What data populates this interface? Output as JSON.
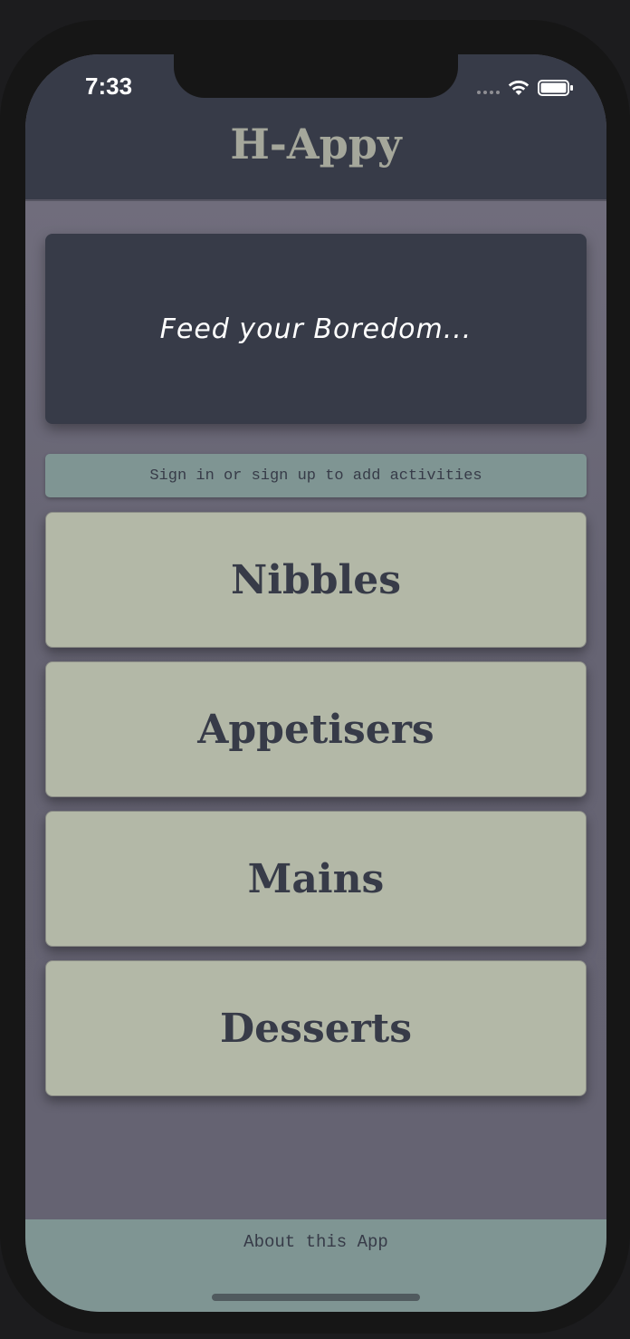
{
  "status_bar": {
    "time": "7:33",
    "icons": [
      "signal-dots-icon",
      "wifi-icon",
      "battery-icon"
    ]
  },
  "header": {
    "title": "H-Appy"
  },
  "hero": {
    "text": "Feed your Boredom..."
  },
  "signin": {
    "label": "Sign in or sign up to add activities"
  },
  "menu": {
    "items": [
      {
        "label": "Nibbles"
      },
      {
        "label": "Appetisers"
      },
      {
        "label": "Mains"
      },
      {
        "label": "Desserts"
      }
    ]
  },
  "footer": {
    "label": "About this App"
  },
  "colors": {
    "header_bg": "#373b48",
    "content_bg": "#666473",
    "card_bg": "#b3b8a7",
    "accent_teal": "#7f9593",
    "title_text": "#a5a79b"
  }
}
